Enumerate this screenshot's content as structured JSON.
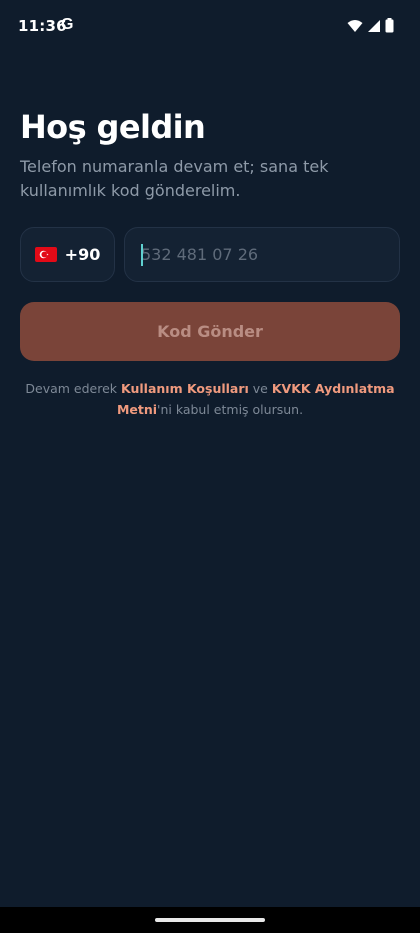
{
  "status_bar": {
    "time": "11:36",
    "google_glyph": "G",
    "icons": [
      "wifi-icon",
      "signal-icon",
      "battery-icon"
    ]
  },
  "login": {
    "title": "Hoş geldin",
    "subtitle": "Telefon numaranla devam et; sana tek kullanımlık kod gönderelim.",
    "country_code": "+90",
    "country_flag": "flag-turkey-icon",
    "phone_value": "",
    "phone_placeholder": "532 481 07 26",
    "send_button_label": "Kod Gönder",
    "terms": {
      "prefix": "Devam ederek ",
      "link1": "Kullanım Koşulları",
      "middle": " ve ",
      "link2": "KVKK Aydınlatma Metni",
      "suffix": "'ni kabul etmiş olursun."
    }
  },
  "colors": {
    "background": "#0f1c2c",
    "field_bg": "#142233",
    "field_border": "#233246",
    "button_bg": "#7a4439",
    "button_text": "#b98d83",
    "link": "#f09a7e",
    "muted_text": "#8e9aa8"
  }
}
